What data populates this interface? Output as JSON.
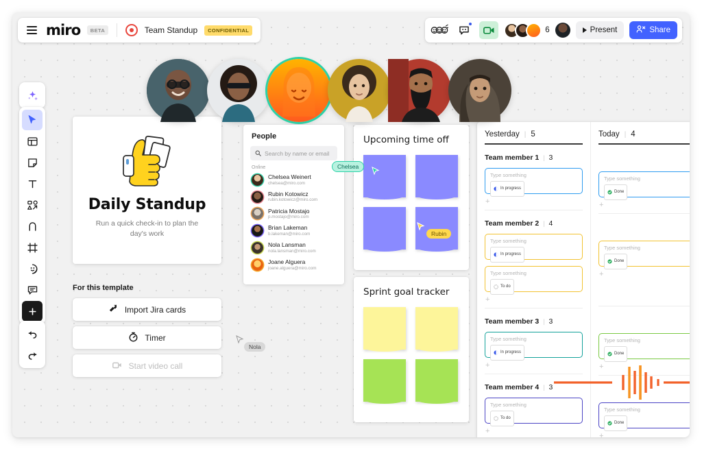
{
  "app": {
    "brand": "miro",
    "beta_badge": "BETA",
    "board_title": "Team Standup",
    "confidential_badge": "CONFIDENTIAL",
    "menu_icon": "hamburger-menu-icon",
    "board_icon": "board-target-icon"
  },
  "topbar_right": {
    "reactions_icon": "emoji-reactions-icon",
    "comment_icon": "comment-bubble-icon",
    "video_icon": "video-camera-icon",
    "participant_count": "6",
    "present_label": "Present",
    "share_label": "Share",
    "share_color": "#4262ff",
    "video_active_color": "#cdf0d8",
    "badge_color": "#3858e9"
  },
  "left_toolbar": {
    "tools": [
      {
        "name": "ai-sparkle-tool",
        "label": "AI",
        "selected": false
      },
      {
        "name": "select-cursor-tool",
        "label": "Select",
        "selected": true
      },
      {
        "name": "templates-tool",
        "label": "Templates",
        "selected": false
      },
      {
        "name": "sticky-note-tool",
        "label": "Sticky note",
        "selected": false
      },
      {
        "name": "text-tool",
        "label": "Text",
        "selected": false
      },
      {
        "name": "shapes-tool",
        "label": "Shapes",
        "selected": false
      },
      {
        "name": "pen-tool",
        "label": "Pen",
        "selected": false
      },
      {
        "name": "frame-tool",
        "label": "Frame",
        "selected": false
      },
      {
        "name": "sticker-tool",
        "label": "Sticker",
        "selected": false
      },
      {
        "name": "comment-tool",
        "label": "Comment",
        "selected": false
      },
      {
        "name": "more-apps-tool",
        "label": "More",
        "selected": false
      }
    ],
    "undo_label": "Undo",
    "redo_label": "Redo"
  },
  "video_strip": {
    "participants": [
      {
        "name": "participant-1",
        "active": false
      },
      {
        "name": "participant-2",
        "active": false
      },
      {
        "name": "participant-3",
        "active": true
      },
      {
        "name": "participant-4",
        "active": false
      },
      {
        "name": "participant-5",
        "active": false
      },
      {
        "name": "participant-6",
        "active": false
      }
    ],
    "active_ring_color": "#2ad2a7"
  },
  "template_card": {
    "title": "Daily Standup",
    "subtitle": "Run a quick check-in to plan the day's work",
    "thumbnail_icon": "thumbs-up-cards-icon"
  },
  "template_actions": {
    "section_label": "For this template",
    "buttons": [
      {
        "label": "Import Jira cards",
        "icon": "jira-icon",
        "disabled": false
      },
      {
        "label": "Timer",
        "icon": "timer-icon",
        "disabled": false
      },
      {
        "label": "Start video call",
        "icon": "video-call-icon",
        "disabled": true
      }
    ]
  },
  "people_panel": {
    "title": "People",
    "search_placeholder": "Search by name or email",
    "search_icon": "search-icon",
    "section_label": "Online",
    "members": [
      {
        "name": "Chelsea Weinert",
        "email": "chelsea@miro.com",
        "ring": "#2ad2a7"
      },
      {
        "name": "Rubin Kotowicz",
        "email": "rubin.kotowicz@miro.com",
        "ring": "#e87d8a"
      },
      {
        "name": "Patricia Mostajo",
        "email": "p.mostajo@miro.com",
        "ring": "#f0a04b"
      },
      {
        "name": "Brian Lakeman",
        "email": "b.lakeman@miro.com",
        "ring": "#7b61ff"
      },
      {
        "name": "Nola Lansman",
        "email": "nola.lansman@miro.com",
        "ring": "#c8d94a"
      },
      {
        "name": "Joane Alguera",
        "email": "joane.alguera@miro.com",
        "ring": "#f5a623"
      }
    ]
  },
  "time_off": {
    "title": "Upcoming time off",
    "note_color": "#8a8aff",
    "notes": [
      "",
      "",
      "",
      ""
    ]
  },
  "sprint_tracker": {
    "title": "Sprint goal tracker",
    "notes": [
      {
        "color": "#fdf59a"
      },
      {
        "color": "#fdf59a"
      },
      {
        "color": "#a6e355"
      },
      {
        "color": "#a6e355"
      }
    ]
  },
  "cursors": [
    {
      "label": "Chelsea",
      "color": "#2ad2a7",
      "text_color": "#0a6b55"
    },
    {
      "label": "Rubin",
      "color": "#ffd84d",
      "text_color": "#6b5200"
    },
    {
      "label": "Nola",
      "color": "#d8d8d8",
      "text_color": "#4a4a4a"
    }
  ],
  "standup_panel": {
    "columns": [
      {
        "title": "Yesterday",
        "count": "5"
      },
      {
        "title": "Today",
        "count": "4"
      }
    ],
    "members": [
      {
        "title": "Team member 1",
        "count": "3",
        "border": "#2d9bf0"
      },
      {
        "title": "Team member 2",
        "count": "4",
        "border": "#f2c230"
      },
      {
        "title": "Team member 3",
        "count": "3",
        "border": "#12a19a"
      },
      {
        "title": "Team member 4",
        "count": "3",
        "border": "#4a43c4"
      }
    ],
    "card_placeholder": "Type something",
    "add_label": "+",
    "statuses": {
      "in_progress": "In progress",
      "done": "Done",
      "to_do": "To do"
    },
    "status_colors": {
      "in_progress": "#3858e9",
      "done": "#2bad5e",
      "to_do": "#9b9b9b"
    },
    "cards": [
      {
        "member": 0,
        "col": 0,
        "status": "in_progress",
        "border": "#2d9bf0"
      },
      {
        "member": 0,
        "col": 1,
        "status": "done",
        "border": "#2d9bf0"
      },
      {
        "member": 1,
        "col": 0,
        "status": "in_progress",
        "border": "#f2c230"
      },
      {
        "member": 1,
        "col": 1,
        "status": "done",
        "border": "#f2c230"
      },
      {
        "member": 1,
        "col": 0,
        "status": "to_do",
        "border": "#f2c230"
      },
      {
        "member": 2,
        "col": 0,
        "status": "in_progress",
        "border": "#12a19a"
      },
      {
        "member": 2,
        "col": 1,
        "status": "done",
        "border": "#7ac943"
      },
      {
        "member": 3,
        "col": 0,
        "status": "to_do",
        "border": "#4a43c4"
      },
      {
        "member": 3,
        "col": 1,
        "status": "done",
        "border": "#4a43c4"
      }
    ]
  },
  "waveform": {
    "name": "audio-waveform-overlay",
    "color": "#f2622a",
    "accent_color": "#f79320"
  }
}
